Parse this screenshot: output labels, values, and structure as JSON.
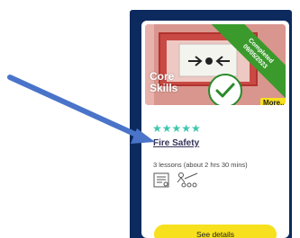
{
  "card": {
    "badge_lines": [
      "Completed",
      "09/05/2023"
    ],
    "hero_title_lines": [
      "Core",
      "Skills"
    ],
    "more_label": "More...",
    "stars": "★★★★★",
    "title": "Fire Safety",
    "lessons_text": "3 lessons (about 2 hrs 30 mins)",
    "button_label": "See details",
    "icons": [
      "document-icon",
      "classroom-icon",
      "checkmark-icon"
    ]
  },
  "colors": {
    "panel": "#0c2a5e",
    "ribbon": "#3a9a2c",
    "accent_yellow": "#f7e01e",
    "stars": "#3ec7ad",
    "pointer": "#4a74c9"
  }
}
